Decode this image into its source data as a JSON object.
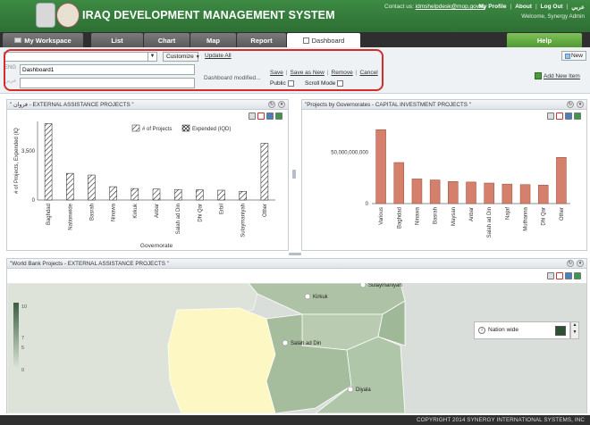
{
  "header": {
    "title": "IRAQ DEVELOPMENT MANAGEMENT SYSTEM",
    "contact_label": "Contact us:",
    "contact_email": "idmshelpdesk@mop.gov.iq",
    "links": [
      "My Profile",
      "About",
      "Log Out",
      "عربي"
    ],
    "welcome": "Welcome, Synergy Admin"
  },
  "nav": {
    "workspace": "My Workspace",
    "list": "List",
    "chart": "Chart",
    "map": "Map",
    "report": "Report",
    "dashboard": "Dashboard",
    "help": "Help"
  },
  "toolbar": {
    "customize": "Customize",
    "update_all": "Update All",
    "label_eng": "ENG",
    "label_ar": "عربي",
    "name_value": "Dashboard1",
    "dashboard_modified": "Dashboard modified...",
    "save": "Save",
    "save_as_new": "Save as New",
    "remove": "Remove",
    "cancel": "Cancel",
    "public": "Public",
    "scroll_mode": "Scroll Mode",
    "new": "New",
    "add_new_item": "Add New Item"
  },
  "panel1": {
    "title": "\" فروان - EXTERNAL ASSISTANCE PROJECTS \""
  },
  "panel2": {
    "title": "\"Projects by Governorates - CAPITAL INVESTMENT PROJECTS \""
  },
  "panel3": {
    "title": "\"World Bank Projects - EXTERNAL ASSISTANCE PROJECTS \"",
    "places": [
      "Sulaymaniyah",
      "Kirkuk",
      "Salah ad Din",
      "Diyala"
    ],
    "scale_ticks": [
      "10",
      "7",
      "5",
      "0"
    ],
    "legend_label": "Nation wide",
    "legend_color": "#2f4f33"
  },
  "footer": {
    "text": "COPYRIGHT 2014 SYNERGY INTERNATIONAL SYSTEMS, INC"
  },
  "chart_data": [
    {
      "type": "bar",
      "title": "",
      "xlabel": "Governorate",
      "ylabel": "# of Projects, Expended (IQ",
      "ylim": [
        0,
        5600
      ],
      "y_ticks": [
        0,
        3500
      ],
      "categories": [
        "Baghdad",
        "Nationwide",
        "Basrah",
        "Ninawa",
        "Kirkuk",
        "Anbar",
        "Salah ad Din",
        "Dhi Qar",
        "Erbil",
        "Sulaymaniyah",
        "Other"
      ],
      "series": [
        {
          "name": "# of Projects",
          "values": [
            5450,
            1900,
            1780,
            950,
            820,
            780,
            750,
            730,
            700,
            620,
            4050
          ]
        },
        {
          "name": "Expended (IQD)",
          "values": [
            0,
            0,
            0,
            0,
            0,
            0,
            0,
            0,
            0,
            0,
            0
          ]
        }
      ],
      "legend": "top-right",
      "grid": false
    },
    {
      "type": "bar",
      "title": "",
      "xlabel": "",
      "ylabel": "",
      "ylim": [
        0,
        80000000000
      ],
      "y_ticks": [
        0,
        50000000000
      ],
      "y_tick_labels": [
        "0",
        "50,000,000,000"
      ],
      "categories": [
        "Various",
        "Baghdad",
        "Ninawa",
        "Basrah",
        "Maysan",
        "Anbar",
        "Salah ad Din",
        "Najaf",
        "Muthanna",
        "Dhi Qar",
        "Other"
      ],
      "values": [
        72000000000,
        40000000000,
        24000000000,
        23000000000,
        21500000000,
        21000000000,
        20000000000,
        19000000000,
        18500000000,
        18000000000,
        45000000000
      ],
      "color": "#d4806c",
      "grid": false
    }
  ]
}
